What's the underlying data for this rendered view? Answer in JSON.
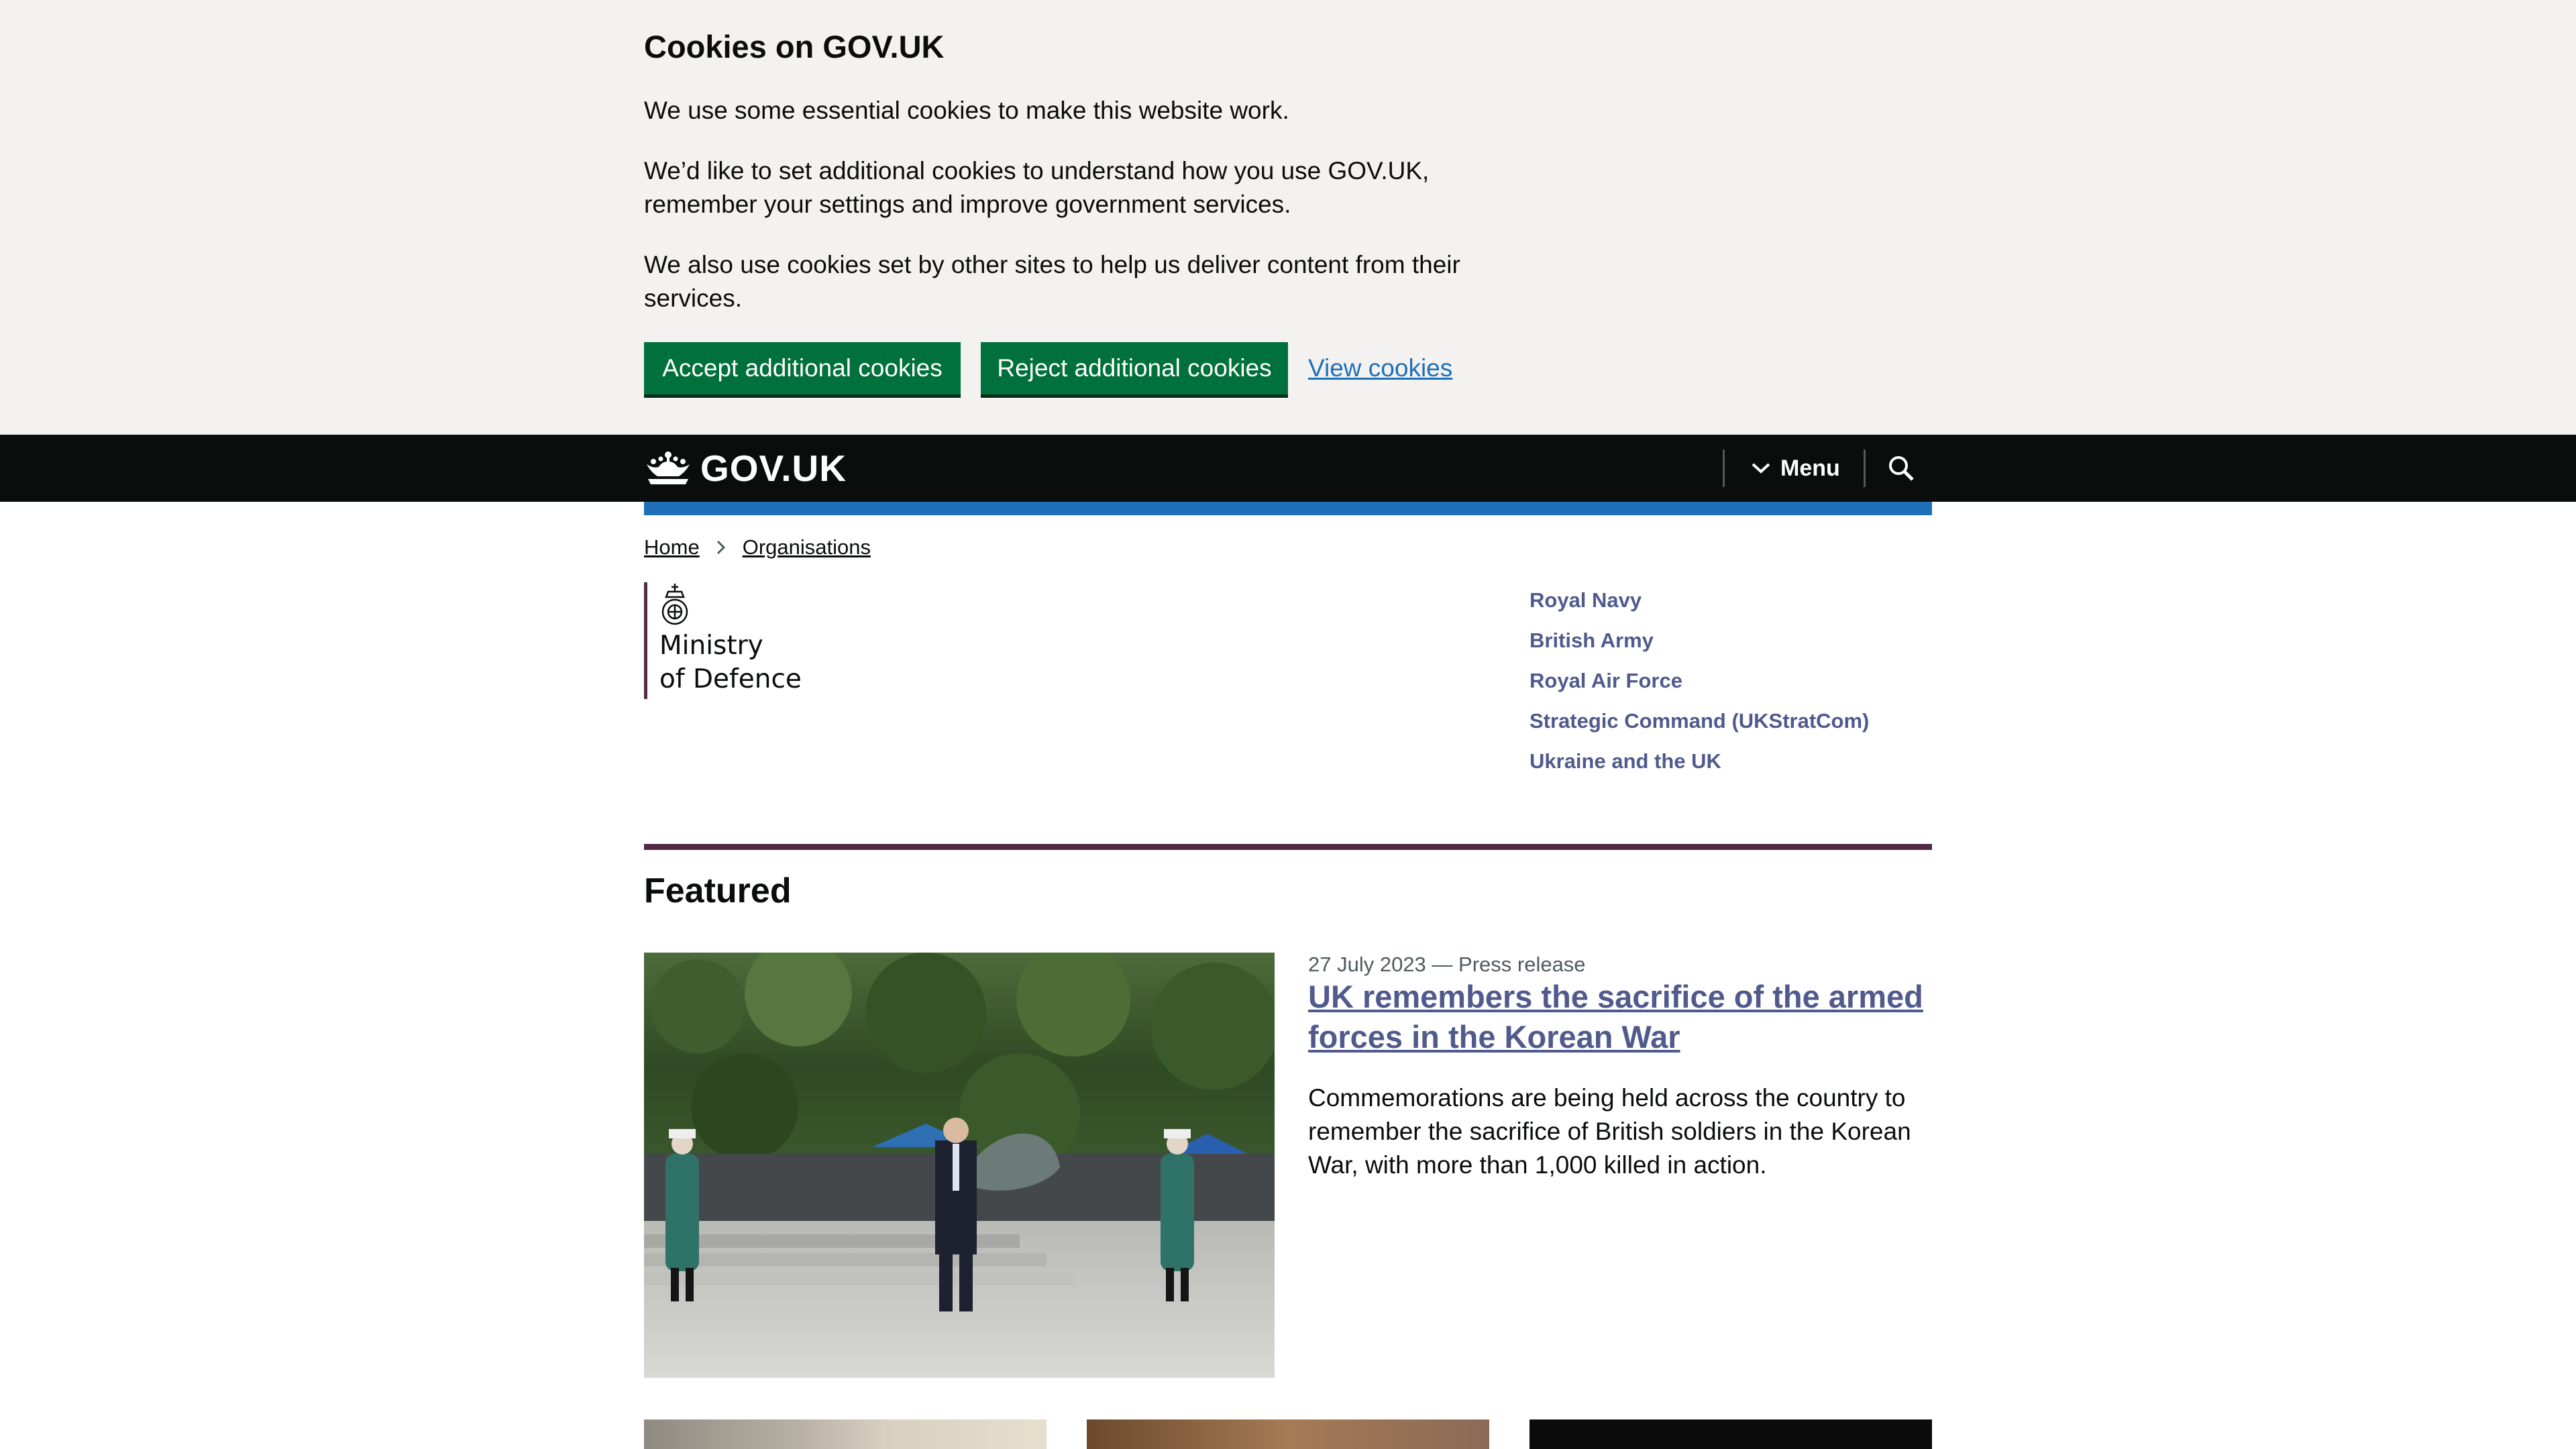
{
  "cookie_banner": {
    "title": "Cookies on GOV.UK",
    "p1": "We use some essential cookies to make this website work.",
    "p2": "We’d like to set additional cookies to understand how you use GOV.UK, remember your settings and improve government services.",
    "p3": "We also use cookies set by other sites to help us deliver content from their services.",
    "accept_label": "Accept additional cookies",
    "reject_label": "Reject additional cookies",
    "view_label": "View cookies"
  },
  "header": {
    "logo_text": "GOV.UK",
    "menu_label": "Menu"
  },
  "breadcrumb": [
    "Home",
    "Organisations"
  ],
  "organisation": {
    "name_line1": "Ministry",
    "name_line2": "of Defence",
    "brand_color": "#532a45"
  },
  "side_links": [
    "Royal Navy",
    "British Army",
    "Royal Air Force",
    "Strategic Command (UKStratCom)",
    "Ukraine and the UK"
  ],
  "featured": {
    "heading": "Featured",
    "main": {
      "meta": "27 July 2023 — Press release",
      "title": "UK remembers the sacrifice of the armed forces in the Korean War",
      "summary": "Commemorations are being held across the country to remember the sacrifice of British soldiers in the Korean War, with more than 1,000 killed in action."
    }
  },
  "colors": {
    "govuk_blue": "#1d70b8",
    "button_green": "#00703c",
    "header_black": "#0b0c0c",
    "banner_grey": "#f3f2f1"
  }
}
